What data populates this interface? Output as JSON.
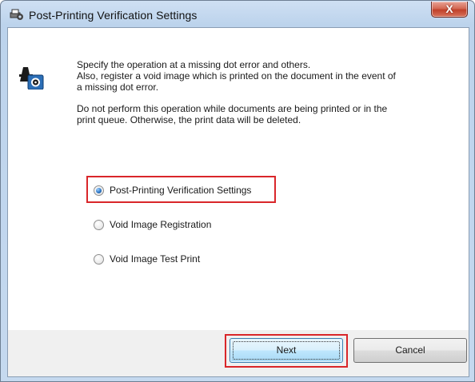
{
  "window": {
    "title": "Post-Printing Verification Settings",
    "close_glyph": "X"
  },
  "description": {
    "paragraph1": "Specify the operation at a missing dot error and others.\nAlso, register a void image which is printed on the document in the event of\na missing dot error.",
    "paragraph2": "Do not perform this operation while documents are being printed or in the\nprint queue. Otherwise, the print data will be deleted."
  },
  "options": [
    {
      "label": "Post-Printing Verification Settings",
      "selected": true
    },
    {
      "label": "Void Image Registration",
      "selected": false
    },
    {
      "label": "Void Image Test Print",
      "selected": false
    }
  ],
  "buttons": {
    "next": "Next",
    "cancel": "Cancel"
  },
  "icons": {
    "app": "printer-settings-icon",
    "info": "printer-gear-icon",
    "close": "close-icon"
  },
  "colors": {
    "highlight": "#d9262a",
    "title_bar": "#c5d9ef",
    "close_button": "#c0412a",
    "default_button": "#bee6fd"
  }
}
